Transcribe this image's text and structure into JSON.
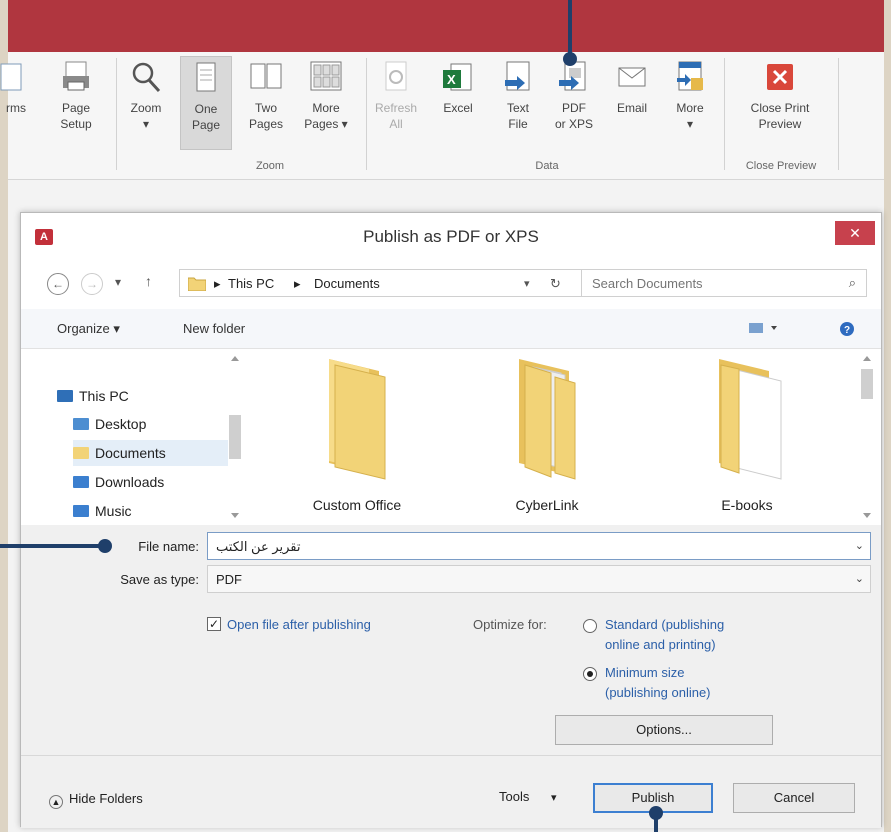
{
  "ribbon": {
    "buttons": [
      {
        "id": "forms",
        "label": "rms"
      },
      {
        "id": "page-setup",
        "label": "Page\nSetup"
      },
      {
        "id": "zoom",
        "label": "Zoom\n▾"
      },
      {
        "id": "one-page",
        "label": "One\nPage"
      },
      {
        "id": "two-pages",
        "label": "Two\nPages"
      },
      {
        "id": "more-pages",
        "label": "More\nPages ▾"
      },
      {
        "id": "refresh-all",
        "label": "Refresh\nAll"
      },
      {
        "id": "excel",
        "label": "Excel"
      },
      {
        "id": "text-file",
        "label": "Text\nFile"
      },
      {
        "id": "pdf-xps",
        "label": "PDF\nor XPS"
      },
      {
        "id": "email",
        "label": "Email"
      },
      {
        "id": "more",
        "label": "More\n▾"
      },
      {
        "id": "close-print-preview",
        "label": "Close Print\nPreview"
      }
    ],
    "groups": {
      "zoom": "Zoom",
      "data": "Data",
      "close_preview": "Close Preview"
    }
  },
  "dialog": {
    "title": "Publish as PDF or XPS",
    "close_label": "✕",
    "address": {
      "root": "This PC",
      "folder": "Documents",
      "sep1": "▸",
      "sep2": "▸"
    },
    "search": {
      "placeholder": "Search Documents"
    },
    "toolbar": {
      "organize": "Organize ▾",
      "new_folder": "New folder"
    },
    "nav_tree": [
      {
        "label": "This PC"
      },
      {
        "label": "Desktop"
      },
      {
        "label": "Documents"
      },
      {
        "label": "Downloads"
      },
      {
        "label": "Music"
      }
    ],
    "files": [
      {
        "name": "Custom Office"
      },
      {
        "name": "CyberLink"
      },
      {
        "name": "E-books"
      }
    ],
    "form": {
      "file_name_label": "File name:",
      "file_name_value": "تقرير عن الكتب",
      "save_type_label": "Save as type:",
      "save_type_value": "PDF",
      "open_after_label": "Open file after publishing",
      "open_after_checked": true,
      "optimize_label": "Optimize for:",
      "standard_label_1": "Standard (publishing",
      "standard_label_2": "online and printing)",
      "minimum_label_1": "Minimum size",
      "minimum_label_2": "(publishing online)",
      "options_label": "Options...",
      "hide_folders_label": "Hide Folders",
      "tools_label": "Tools",
      "tools_caret": "▾",
      "publish_label": "Publish",
      "cancel_label": "Cancel"
    }
  },
  "colors": {
    "titlebar": "#b0363f",
    "annotation": "#1f3f6a",
    "link_blue": "#2b5fa8",
    "folder_yellow": "#f2d377"
  }
}
